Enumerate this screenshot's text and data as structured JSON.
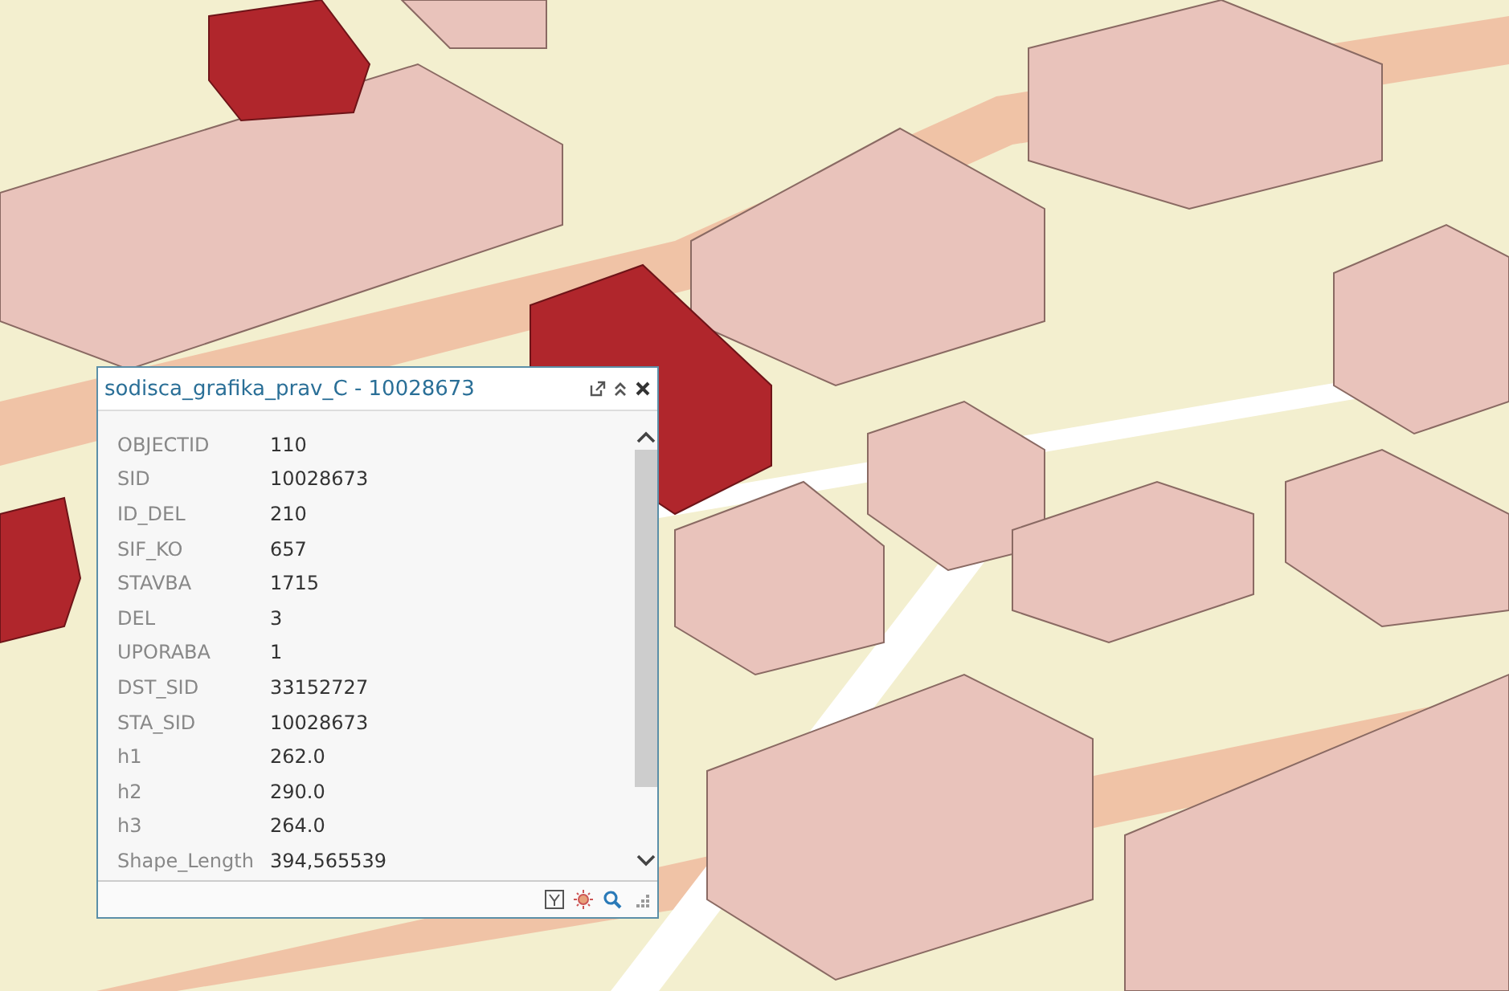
{
  "popup": {
    "title": "sodisca_grafika_prav_C - 10028673",
    "fields": [
      {
        "name": "OBJECTID",
        "value": "110"
      },
      {
        "name": "SID",
        "value": "10028673"
      },
      {
        "name": "ID_DEL",
        "value": "210"
      },
      {
        "name": "SIF_KO",
        "value": "657"
      },
      {
        "name": "STAVBA",
        "value": "1715"
      },
      {
        "name": "DEL",
        "value": "3"
      },
      {
        "name": "UPORABA",
        "value": "1"
      },
      {
        "name": "DST_SID",
        "value": "33152727"
      },
      {
        "name": "STA_SID",
        "value": "10028673"
      },
      {
        "name": "h1",
        "value": "262.0"
      },
      {
        "name": "h2",
        "value": "290.0"
      },
      {
        "name": "h3",
        "value": "264.0"
      },
      {
        "name": "Shape_Length",
        "value": "394,565539"
      }
    ]
  }
}
